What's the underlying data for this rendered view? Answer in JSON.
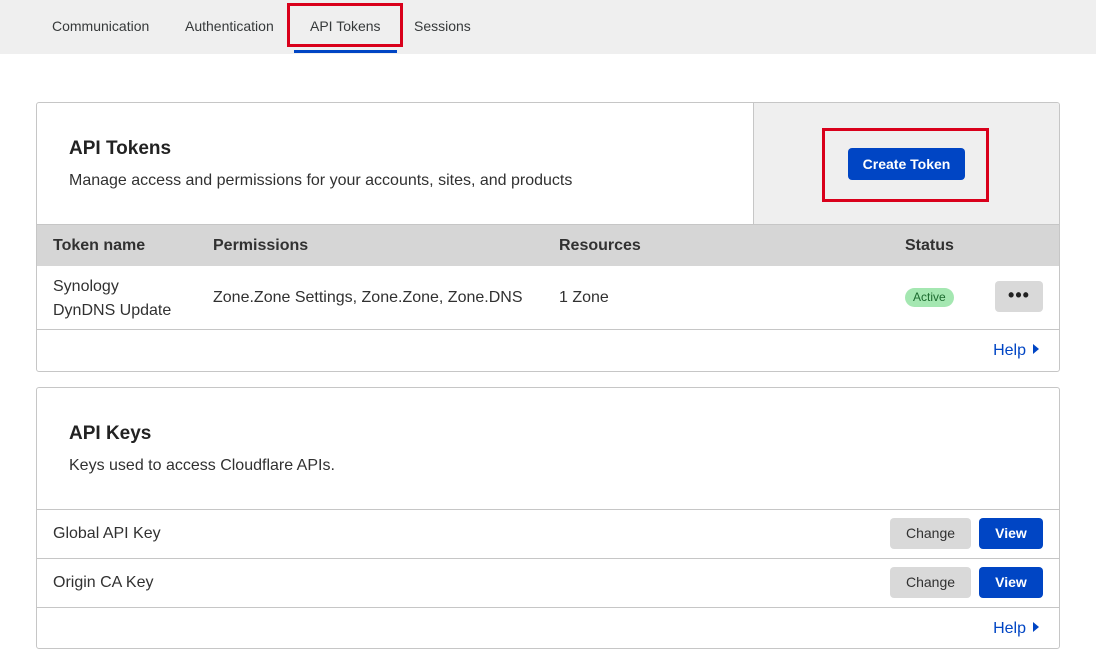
{
  "tabs": [
    {
      "label": "Communication"
    },
    {
      "label": "Authentication"
    },
    {
      "label": "API Tokens"
    },
    {
      "label": "Sessions"
    }
  ],
  "tokens_card": {
    "title": "API Tokens",
    "description": "Manage access and permissions for your accounts, sites, and products",
    "create_button": "Create Token",
    "columns": [
      "Token name",
      "Permissions",
      "Resources",
      "Status"
    ],
    "rows": [
      {
        "name_line1": "Synology",
        "name_line2": "DynDNS Update",
        "permissions": "Zone.Zone Settings, Zone.Zone, Zone.DNS",
        "resources": "1 Zone",
        "status": "Active",
        "more_icon": "•••"
      }
    ],
    "help": "Help"
  },
  "keys_card": {
    "title": "API Keys",
    "description": "Keys used to access Cloudflare APIs.",
    "rows": [
      {
        "label": "Global API Key",
        "change": "Change",
        "view": "View"
      },
      {
        "label": "Origin CA Key",
        "change": "Change",
        "view": "View"
      }
    ],
    "help": "Help"
  },
  "colors": {
    "accent": "#0045c4",
    "highlight": "#d9001b",
    "active_badge": "#a4e7b1"
  }
}
